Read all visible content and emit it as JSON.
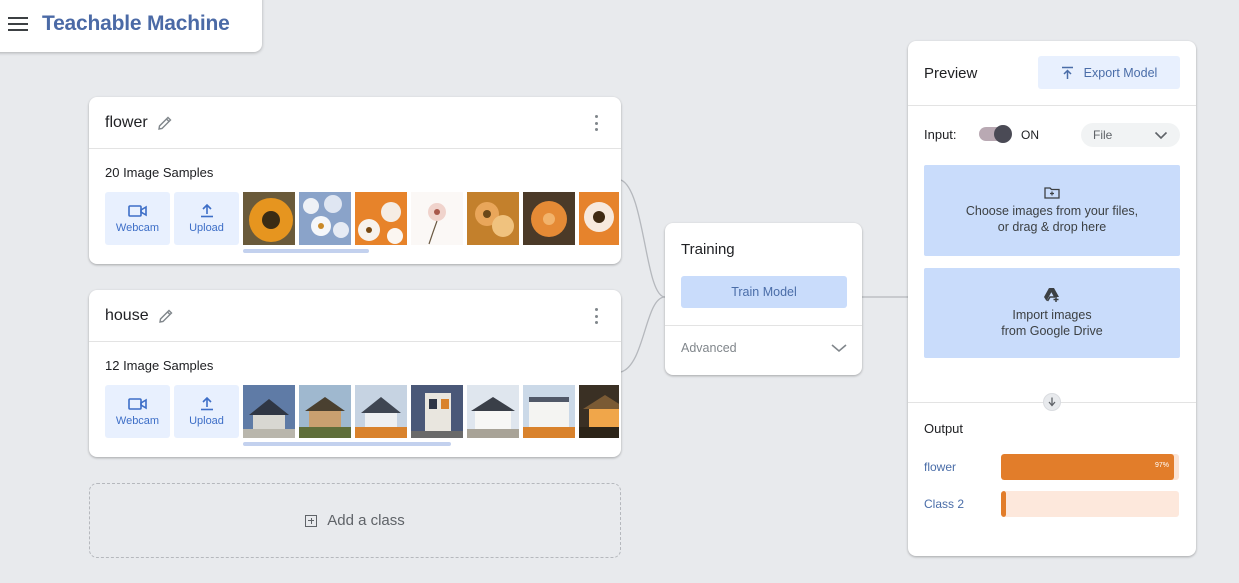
{
  "app": {
    "title": "Teachable Machine"
  },
  "classes": [
    {
      "name": "flower",
      "samples_label": "20 Image Samples",
      "webcam_label": "Webcam",
      "upload_label": "Upload"
    },
    {
      "name": "house",
      "samples_label": "12 Image Samples",
      "webcam_label": "Webcam",
      "upload_label": "Upload"
    }
  ],
  "add_class": {
    "label": "Add a class"
  },
  "training": {
    "title": "Training",
    "train_button": "Train Model",
    "advanced_label": "Advanced"
  },
  "preview": {
    "title": "Preview",
    "export_button": "Export Model",
    "input_label": "Input:",
    "toggle_state": "ON",
    "input_source": "File",
    "drop_files_line1": "Choose images from your files,",
    "drop_files_line2": "or drag & drop here",
    "drive_line1": "Import images",
    "drive_line2": "from Google Drive",
    "output_title": "Output",
    "outputs": [
      {
        "label": "flower",
        "value": 97,
        "display": "97%"
      },
      {
        "label": "Class 2",
        "value": 3,
        "display": ""
      }
    ]
  },
  "colors": {
    "accent": "#4a6da8",
    "light_blue": "#c9dcfb",
    "output_bar": "#e27d2a"
  }
}
